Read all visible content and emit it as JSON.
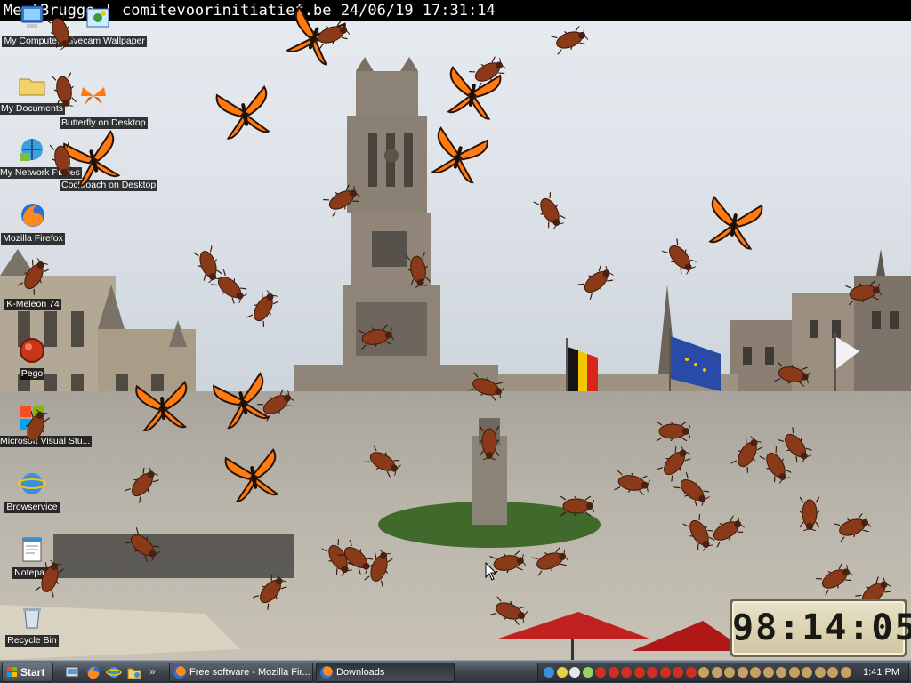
{
  "banner": {
    "title": "MeetBrugge | comitevoorinitiatief.be 24/06/19 17:31:14"
  },
  "desktop_icons": [
    {
      "label": "My Computer",
      "icon": "computer-icon"
    },
    {
      "label": "Livecam Wallpaper",
      "icon": "camera-icon"
    },
    {
      "label": "My Documents",
      "icon": "folder-icon"
    },
    {
      "label": "Butterfly on Desktop",
      "icon": "butterfly-icon"
    },
    {
      "label": "My Network Places",
      "icon": "network-icon"
    },
    {
      "label": "Cockroach on Desktop",
      "icon": "cockroach-icon"
    },
    {
      "label": "Mozilla Firefox",
      "icon": "firefox-icon"
    },
    {
      "label": "K-Meleon 74",
      "icon": "k-meleon-icon"
    },
    {
      "label": "Pego",
      "icon": "pego-icon"
    },
    {
      "label": "Microsoft Visual Stu...",
      "icon": "visual-studio-icon"
    },
    {
      "label": "Browservice",
      "icon": "browser-icon"
    },
    {
      "label": "Notepad",
      "icon": "notepad-icon"
    },
    {
      "label": "Recycle Bin",
      "icon": "recycle-bin-icon"
    }
  ],
  "clock": {
    "time": "98:14:05"
  },
  "taskbar": {
    "start_label": "Start",
    "quick_launch": [
      "show-desktop-icon",
      "firefox-icon",
      "ie-icon",
      "explorer-icon",
      "media-icon"
    ],
    "overflow_label": "»",
    "windows": [
      {
        "label": "Free software - Mozilla Fir...",
        "icon": "firefox-icon",
        "active": false
      },
      {
        "label": "Downloads",
        "icon": "firefox-icon",
        "active": true
      }
    ],
    "tray_time": "1:41 PM"
  },
  "colors": {
    "taskbar": "#3e454e",
    "banner_bg": "#000000",
    "banner_text": "#ffffff",
    "butterfly_orange": "#ff7a10",
    "cockroach_brown": "#8a3a18"
  }
}
